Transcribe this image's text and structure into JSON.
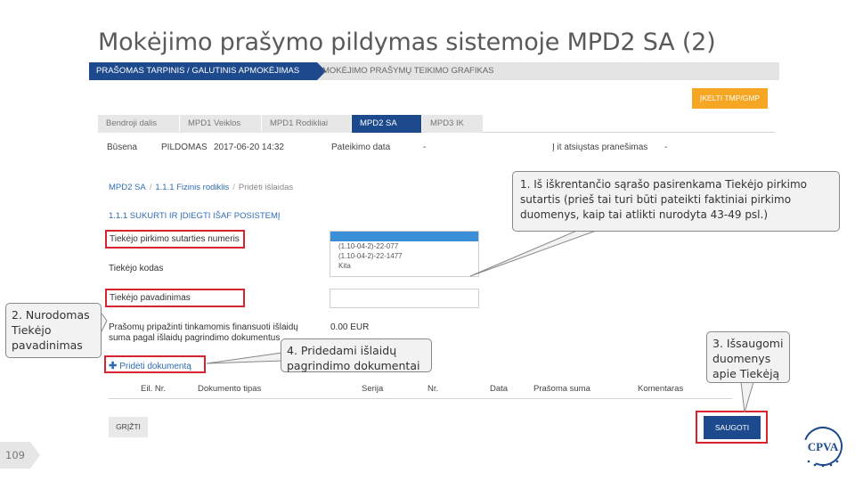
{
  "slide": {
    "title": "Mokėjimo prašymo pildymas sistemoje MPD2 SA (2)",
    "page_number": "109"
  },
  "app": {
    "topnav": {
      "active": "PRAŠOMAS TARPINIS / GALUTINIS APMOKĖJIMAS",
      "inactive": "MOKĖJIMO PRAŠYMŲ TEIKIMO GRAFIKAS"
    },
    "orange_button": "ĮKELTI TMP/GMP",
    "tabs": [
      "Bendroji dalis",
      "MPD1 Veiklos",
      "MPD1 Rodikliai",
      "MPD2 SA",
      "MPD3 IK"
    ],
    "active_tab_index": 3,
    "status": {
      "state_label": "Būsena",
      "state_value": "PILDOMAS",
      "state_date": "2017-06-20 14:32",
      "submitted_label": "Pateikimo data",
      "submitted_value": "-",
      "answer_label": "Į it atsiųstas pranešimas",
      "answer_value": "-"
    },
    "breadcrumb": [
      "MPD2 SA",
      "1.1.1 Fizinis rodiklis",
      "Pridėti išlaidas"
    ],
    "section_title": "1.1.1 SUKURTI IR ĮDIEGTI IŠAF POSISTEMĮ",
    "form": {
      "contract_label": "Tiekėjo pirkimo sutarties numeris",
      "supplier_code_label": "Tiekėjo kodas",
      "supplier_name_label": "Tiekėjo pavadinimas",
      "dropdown_options": [
        "(1.10-04-2)-22-077",
        "(1.10-04-2)-22-1477",
        "Kita"
      ],
      "amount_label": "Prašomų pripažinti tinkamomis finansuoti išlaidų suma pagal išlaidų pagrindimo dokumentus",
      "amount_value": "0.00 EUR",
      "add_document": "Pridėti dokumentą"
    },
    "table_columns": [
      "Eil. Nr.",
      "Dokumento tipas",
      "Serija",
      "Nr.",
      "Data",
      "Prašoma suma",
      "Komentaras"
    ],
    "back_button": "GRĮŽTI",
    "save_button": "SAUGOTI"
  },
  "callouts": {
    "c1": "1. Iš iškrentančio sąrašo pasirenkama Tiekėjo pirkimo sutartis (prieš tai turi būti pateikti faktiniai pirkimo duomenys, kaip tai atlikti nurodyta 43-49 psl.)",
    "c2": "2. Nurodomas Tiekėjo pavadinimas",
    "c3": "3. Išsaugomi duomenys apie Tiekėją",
    "c4": "4. Pridedami išlaidų pagrindimo dokumentai"
  },
  "logo_text": "CPVA",
  "colors": {
    "brand_blue": "#1d4a8c",
    "link_blue": "#2f6db3",
    "accent_orange": "#f5a623",
    "highlight_red": "#d9232e"
  }
}
